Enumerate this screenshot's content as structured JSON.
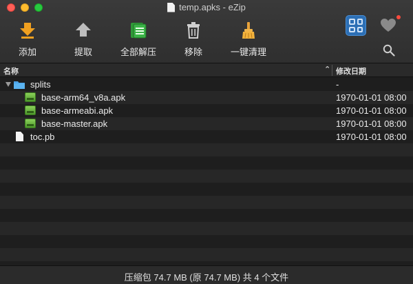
{
  "window": {
    "title": "temp.apks - eZip"
  },
  "toolbar": {
    "add_label": "添加",
    "extract_label": "提取",
    "extract_all_label": "全部解压",
    "remove_label": "移除",
    "clean_label": "一键清理"
  },
  "table": {
    "columns": {
      "name": "名称",
      "modified": "修改日期"
    },
    "rows": [
      {
        "name": "splits",
        "date": "-"
      },
      {
        "name": "base-arm64_v8a.apk",
        "date": "1970-01-01 08:00"
      },
      {
        "name": "base-armeabi.apk",
        "date": "1970-01-01 08:00"
      },
      {
        "name": "base-master.apk",
        "date": "1970-01-01 08:00"
      },
      {
        "name": "toc.pb",
        "date": "1970-01-01 08:00"
      }
    ]
  },
  "status": {
    "text": "压缩包 74.7 MB (原 74.7 MB) 共 4 个文件"
  },
  "colors": {
    "accent_blue": "#2c6fb5",
    "folder_blue": "#4aa3e8",
    "apk_green": "#6cbf3c",
    "notification_red": "#ff4a3d"
  },
  "icons": {
    "add": "download-arrow-icon",
    "extract": "upload-arrow-icon",
    "extract_all": "document-stack-icon",
    "remove": "trash-icon",
    "clean": "broom-icon",
    "view": "grid-view-icon",
    "favorite": "heart-icon",
    "search": "search-icon"
  }
}
